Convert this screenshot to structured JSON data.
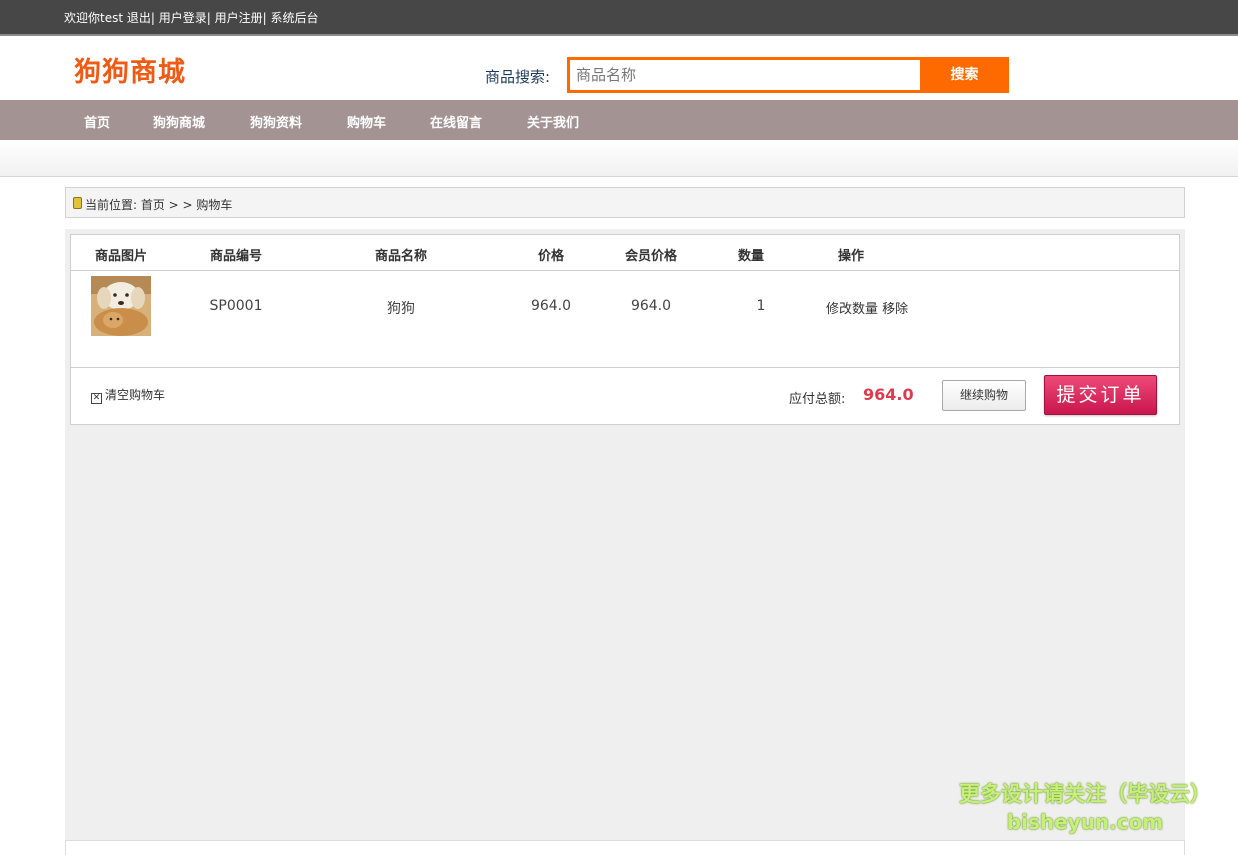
{
  "topbar": {
    "welcome": "欢迎你test",
    "logout": "退出",
    "sep": "|",
    "user_login": "用户登录",
    "user_register": "用户注册",
    "admin": "系统后台"
  },
  "header": {
    "brand": "狗狗商城",
    "search_label": "商品搜索:",
    "search_placeholder": "商品名称",
    "search_button": "搜索"
  },
  "nav": [
    "首页",
    "狗狗商城",
    "狗狗资料",
    "购物车",
    "在线留言",
    "关于我们"
  ],
  "breadcrumb": {
    "text": "当前位置: 首页 > > 购物车"
  },
  "cart": {
    "columns": [
      "商品图片",
      "商品编号",
      "商品名称",
      "价格",
      "会员价格",
      "数量",
      "操作"
    ],
    "rows": [
      {
        "code": "SP0001",
        "name": "狗狗",
        "price": "964.0",
        "member_price": "964.0",
        "quantity": "1",
        "op_modify": "修改数量",
        "op_remove": "移除"
      }
    ],
    "clear_label": "清空购物车",
    "total_label": "应付总额:",
    "total_value": "964.0",
    "continue_label": "继续购物",
    "submit_label": "提交订单"
  },
  "watermark": {
    "line1": "更多设计请关注（毕设云）",
    "line2": "bisheyun.com"
  },
  "colors": {
    "accent": "#ff6a00",
    "brand": "#f05a14",
    "nav_bg": "#a39493",
    "topbar_bg": "#474747",
    "total": "#e03a4f",
    "submit": "#d91f57"
  }
}
